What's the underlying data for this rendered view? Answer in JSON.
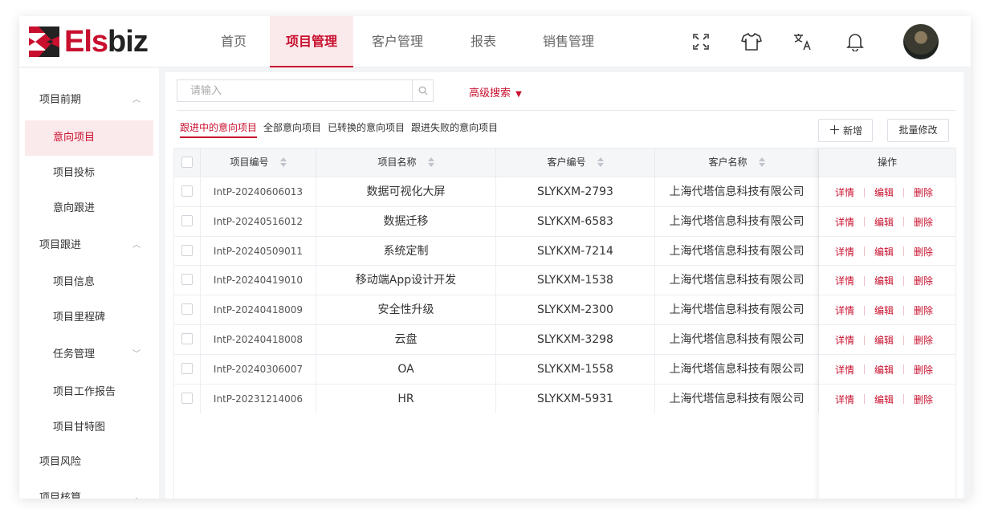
{
  "brand": {
    "name_prefix": "Els",
    "name_suffix": "biz",
    "accent": "#c8102e"
  },
  "nav": [
    {
      "label": "首页",
      "active": false
    },
    {
      "label": "项目管理",
      "active": true
    },
    {
      "label": "客户管理",
      "active": false
    },
    {
      "label": "报表",
      "active": false
    },
    {
      "label": "销售管理",
      "active": false
    }
  ],
  "header_icons": [
    "fullscreen-icon",
    "theme-shirt-icon",
    "translate-icon",
    "bell-icon"
  ],
  "sidebar": {
    "items": [
      {
        "label": "项目前期",
        "type": "group",
        "caret": "up"
      },
      {
        "label": "意向项目",
        "type": "sub",
        "active": true
      },
      {
        "label": "项目投标",
        "type": "sub"
      },
      {
        "label": "意向跟进",
        "type": "sub"
      },
      {
        "label": "项目跟进",
        "type": "group",
        "caret": "up"
      },
      {
        "label": "项目信息",
        "type": "sub"
      },
      {
        "label": "项目里程碑",
        "type": "sub"
      },
      {
        "label": "任务管理",
        "type": "sub",
        "caret": "down"
      },
      {
        "label": "项目工作报告",
        "type": "sub"
      },
      {
        "label": "项目甘特图",
        "type": "sub"
      },
      {
        "label": "项目风险",
        "type": "group"
      },
      {
        "label": "项目核算",
        "type": "group",
        "caret": "up"
      }
    ]
  },
  "search": {
    "placeholder": "请输入",
    "advanced_label": "高级搜索"
  },
  "tabs": [
    {
      "label": "跟进中的意向项目",
      "active": true
    },
    {
      "label": "全部意向项目",
      "active": false
    },
    {
      "label": "已转换的意向项目",
      "active": false
    },
    {
      "label": "跟进失败的意向项目",
      "active": false
    }
  ],
  "actions": {
    "add": "新增",
    "batch_edit": "批量修改"
  },
  "table": {
    "columns": [
      "项目编号",
      "项目名称",
      "客户编号",
      "客户名称",
      "操作"
    ],
    "rows": [
      {
        "code": "IntP-20240606013",
        "name": "数据可视化大屏",
        "customer_code": "SLYKXM-2793",
        "customer_name": "上海代塔信息科技有限公司"
      },
      {
        "code": "IntP-20240516012",
        "name": "数据迁移",
        "customer_code": "SLYKXM-6583",
        "customer_name": "上海代塔信息科技有限公司"
      },
      {
        "code": "IntP-20240509011",
        "name": "系统定制",
        "customer_code": "SLYKXM-7214",
        "customer_name": "上海代塔信息科技有限公司"
      },
      {
        "code": "IntP-20240419010",
        "name": "移动端App设计开发",
        "customer_code": "SLYKXM-1538",
        "customer_name": "上海代塔信息科技有限公司"
      },
      {
        "code": "IntP-20240418009",
        "name": "安全性升级",
        "customer_code": "SLYKXM-2300",
        "customer_name": "上海代塔信息科技有限公司"
      },
      {
        "code": "IntP-20240418008",
        "name": "云盘",
        "customer_code": "SLYKXM-3298",
        "customer_name": "上海代塔信息科技有限公司"
      },
      {
        "code": "IntP-20240306007",
        "name": "OA",
        "customer_code": "SLYKXM-1558",
        "customer_name": "上海代塔信息科技有限公司"
      },
      {
        "code": "IntP-20231214006",
        "name": "HR",
        "customer_code": "SLYKXM-5931",
        "customer_name": "上海代塔信息科技有限公司"
      }
    ],
    "row_actions": [
      "详情",
      "编辑",
      "删除"
    ]
  }
}
